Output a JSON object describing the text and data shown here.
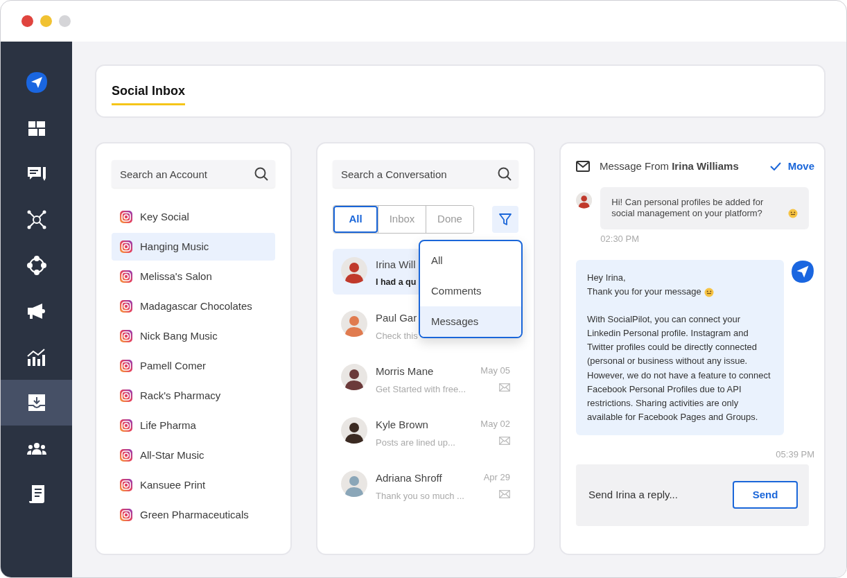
{
  "sidebar": {
    "items": [
      {
        "kind": "logo",
        "selected": false
      },
      {
        "kind": "dashboard",
        "selected": false
      },
      {
        "kind": "compose",
        "selected": false
      },
      {
        "kind": "network",
        "selected": false
      },
      {
        "kind": "cycle",
        "selected": false
      },
      {
        "kind": "megaphone",
        "selected": false
      },
      {
        "kind": "chart",
        "selected": false
      },
      {
        "kind": "inbox",
        "selected": true
      },
      {
        "kind": "team",
        "selected": false
      },
      {
        "kind": "document",
        "selected": false
      }
    ]
  },
  "header": {
    "title": "Social Inbox"
  },
  "accounts": {
    "search": {
      "placeholder": "Search an Account"
    },
    "items": [
      {
        "name": "Key Social",
        "selected": false
      },
      {
        "name": "Hanging Music",
        "selected": true
      },
      {
        "name": "Melissa's Salon",
        "selected": false
      },
      {
        "name": "Madagascar Chocolates",
        "selected": false
      },
      {
        "name": "Nick Bang Music",
        "selected": false
      },
      {
        "name": "Pamell Comer",
        "selected": false
      },
      {
        "name": "Rack's Pharmacy",
        "selected": false
      },
      {
        "name": "Life Pharma",
        "selected": false
      },
      {
        "name": "All-Star Music",
        "selected": false
      },
      {
        "name": "Kansuee Print",
        "selected": false
      },
      {
        "name": "Green Pharmaceuticals",
        "selected": false
      }
    ]
  },
  "conversations": {
    "search": {
      "placeholder": "Search a Conversation"
    },
    "filter_tabs": [
      {
        "label": "All",
        "selected": true
      },
      {
        "label": "Inbox",
        "selected": false
      },
      {
        "label": "Done",
        "selected": false
      }
    ],
    "items": [
      {
        "name": "Irina Will",
        "preview": "I had a qu",
        "unread": true,
        "selected": true
      },
      {
        "name": "Paul Gar",
        "preview": "Check this",
        "unread": false,
        "selected": false
      },
      {
        "name": "Morris Mane",
        "preview": "Get Started with free...",
        "date": "May 05",
        "unread": false,
        "selected": false
      },
      {
        "name": "Kyle Brown",
        "preview": "Posts are lined up...",
        "date": "May 02",
        "unread": false,
        "selected": false
      },
      {
        "name": "Adriana Shroff",
        "preview": "Thank you so much ...",
        "date": "Apr 29",
        "unread": false,
        "selected": false
      }
    ],
    "dropdown": {
      "options": [
        {
          "label": "All",
          "selected": false
        },
        {
          "label": "Comments",
          "selected": false
        },
        {
          "label": "Messages",
          "selected": true
        }
      ]
    }
  },
  "message": {
    "heading": "Message From **Irina Williams**",
    "action": "Move",
    "incoming": {
      "text": "Hi! Can personal profiles be added for social management on your platform?",
      "time": "02:30 PM"
    },
    "outgoing": {
      "greeting": "Hey Irina,\nThank you for your message",
      "body": "With SocialPilot, you can connect your Linkedin Personal profile. Instagram and Twitter profiles could be directly connected (personal or business without any issue. However, we do not have a feature to connect Facebook Personal Profiles due to API restrictions. Sharing activities are only available for Facebook Pages and Groups.",
      "time": "05:39 PM"
    },
    "reply": {
      "placeholder": "Send Irina a reply...",
      "button": "Send"
    }
  }
}
